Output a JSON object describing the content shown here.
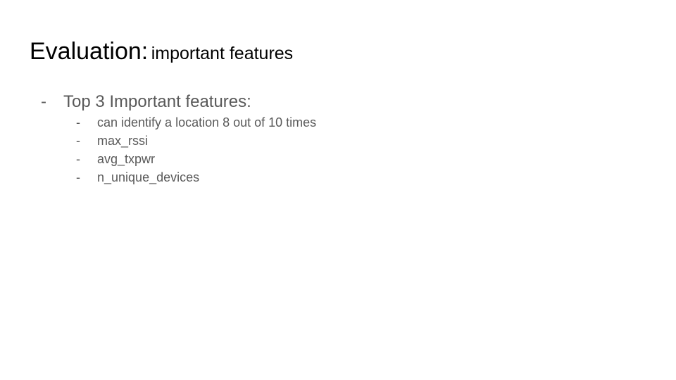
{
  "slide": {
    "title_main": "Evaluation:",
    "title_sub": "important features",
    "bullet": {
      "marker": "-",
      "label": "Top 3 Important features:",
      "items": [
        {
          "marker": "-",
          "label": "can identify a location 8 out of 10 times"
        },
        {
          "marker": "-",
          "label": "max_rssi"
        },
        {
          "marker": "-",
          "label": "avg_txpwr"
        },
        {
          "marker": "-",
          "label": "n_unique_devices"
        }
      ]
    }
  }
}
